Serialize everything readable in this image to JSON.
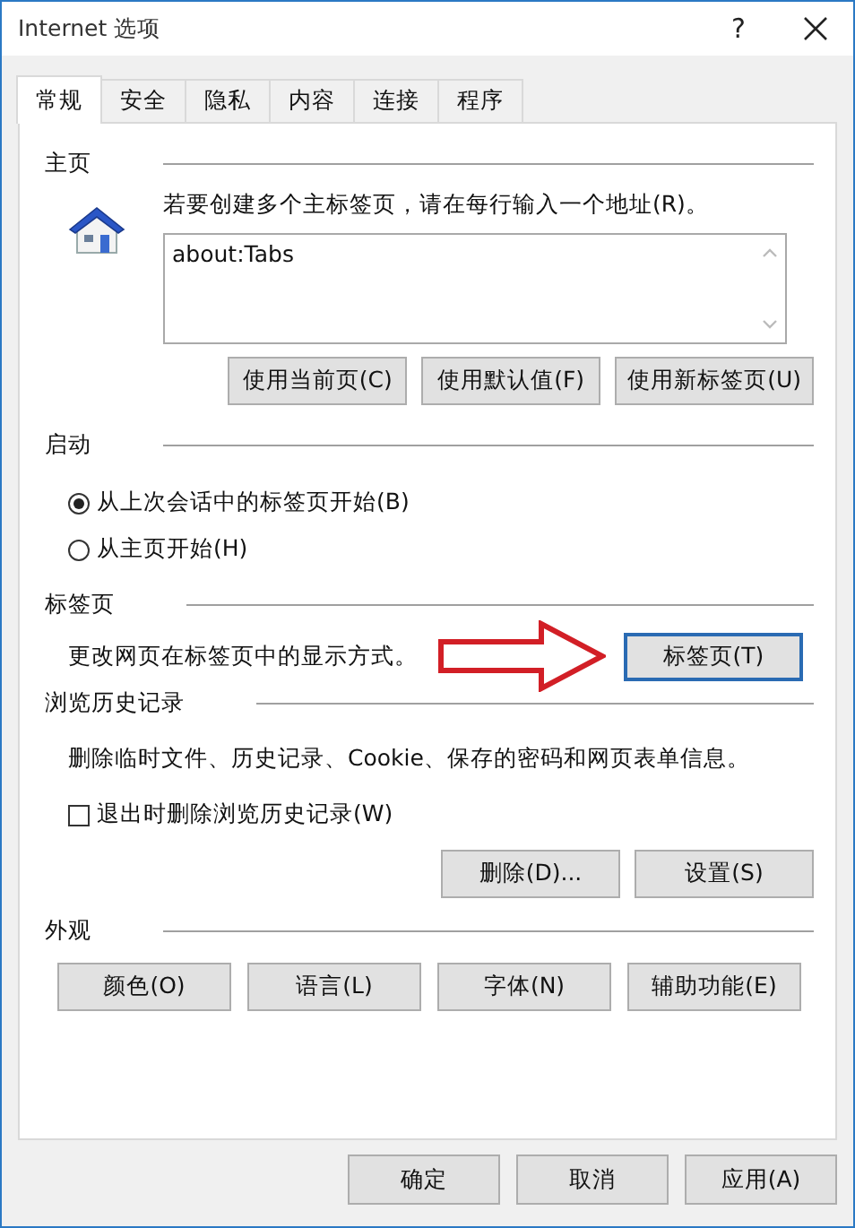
{
  "window": {
    "title": "Internet 选项",
    "help": "?"
  },
  "tabs": [
    {
      "label": "常规",
      "selected": true
    },
    {
      "label": "安全",
      "selected": false
    },
    {
      "label": "隐私",
      "selected": false
    },
    {
      "label": "内容",
      "selected": false
    },
    {
      "label": "连接",
      "selected": false
    },
    {
      "label": "程序",
      "selected": false
    }
  ],
  "homepage": {
    "heading": "主页",
    "instruction": "若要创建多个主标签页，请在每行输入一个地址(R)。",
    "value": "about:Tabs",
    "buttons": [
      "使用当前页(C)",
      "使用默认值(F)",
      "使用新标签页(U)"
    ]
  },
  "startup": {
    "heading": "启动",
    "options": [
      {
        "label": "从上次会话中的标签页开始(B)",
        "selected": true
      },
      {
        "label": "从主页开始(H)",
        "selected": false
      }
    ]
  },
  "tabs_section": {
    "heading": "标签页",
    "description": "更改网页在标签页中的显示方式。",
    "button": "标签页(T)",
    "focused": true
  },
  "history": {
    "heading": "浏览历史记录",
    "description": "删除临时文件、历史记录、Cookie、保存的密码和网页表单信息。",
    "checkbox": {
      "label": "退出时删除浏览历史记录(W)",
      "checked": false
    },
    "buttons": [
      "删除(D)...",
      "设置(S)"
    ]
  },
  "appearance": {
    "heading": "外观",
    "buttons": [
      "颜色(O)",
      "语言(L)",
      "字体(N)",
      "辅助功能(E)"
    ]
  },
  "dialog_buttons": [
    "确定",
    "取消",
    "应用(A)"
  ]
}
